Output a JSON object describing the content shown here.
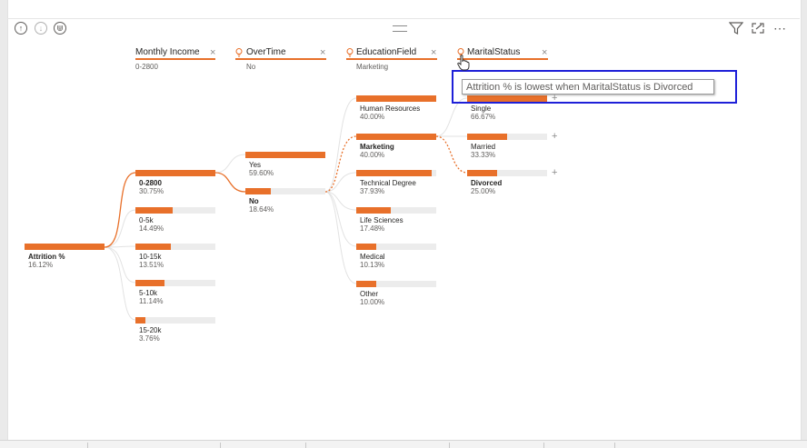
{
  "toolbar": {
    "icons": [
      "drill-up-icon",
      "drill-down-icon",
      "expand-hierarchy-icon",
      "filter-icon",
      "focus-mode-icon",
      "more-options-icon"
    ]
  },
  "levels": [
    {
      "title": "Monthly Income",
      "selected": "0-2800",
      "has_bulb": false
    },
    {
      "title": "OverTime",
      "selected": "No",
      "has_bulb": true
    },
    {
      "title": "EducationField",
      "selected": "Marketing",
      "has_bulb": true
    },
    {
      "title": "MaritalStatus",
      "selected": "",
      "has_bulb": true
    }
  ],
  "root": {
    "label": "Attrition %",
    "value": "16.12%",
    "fraction": 1.0
  },
  "income_nodes": [
    {
      "label": "0-2800",
      "value": "30.75%",
      "fraction": 1.0,
      "selected": true
    },
    {
      "label": "0-5k",
      "value": "14.49%",
      "fraction": 0.471,
      "selected": false
    },
    {
      "label": "10-15k",
      "value": "13.51%",
      "fraction": 0.439,
      "selected": false
    },
    {
      "label": "5-10k",
      "value": "11.14%",
      "fraction": 0.362,
      "selected": false
    },
    {
      "label": "15-20k",
      "value": "3.76%",
      "fraction": 0.122,
      "selected": false
    }
  ],
  "overtime_nodes": [
    {
      "label": "Yes",
      "value": "59.60%",
      "fraction": 1.0,
      "selected": false
    },
    {
      "label": "No",
      "value": "18.64%",
      "fraction": 0.313,
      "selected": true
    }
  ],
  "education_nodes": [
    {
      "label": "Human Resources",
      "value": "40.00%",
      "fraction": 1.0,
      "selected": false
    },
    {
      "label": "Marketing",
      "value": "40.00%",
      "fraction": 1.0,
      "selected": true
    },
    {
      "label": "Technical Degree",
      "value": "37.93%",
      "fraction": 0.948,
      "selected": false
    },
    {
      "label": "Life Sciences",
      "value": "17.48%",
      "fraction": 0.437,
      "selected": false
    },
    {
      "label": "Medical",
      "value": "10.13%",
      "fraction": 0.253,
      "selected": false
    },
    {
      "label": "Other",
      "value": "10.00%",
      "fraction": 0.25,
      "selected": false
    }
  ],
  "marital_nodes": [
    {
      "label": "Single",
      "value": "66.67%",
      "fraction": 1.0,
      "selected": false
    },
    {
      "label": "Married",
      "value": "33.33%",
      "fraction": 0.5,
      "selected": false
    },
    {
      "label": "Divorced",
      "value": "25.00%",
      "fraction": 0.375,
      "selected": true
    }
  ],
  "tooltip": {
    "text": "Attrition % is lowest when MaritalStatus is Divorced"
  },
  "colors": {
    "accent": "#e8702a",
    "bar_bg": "#ececec",
    "highlight_box": "#1e20d8"
  }
}
